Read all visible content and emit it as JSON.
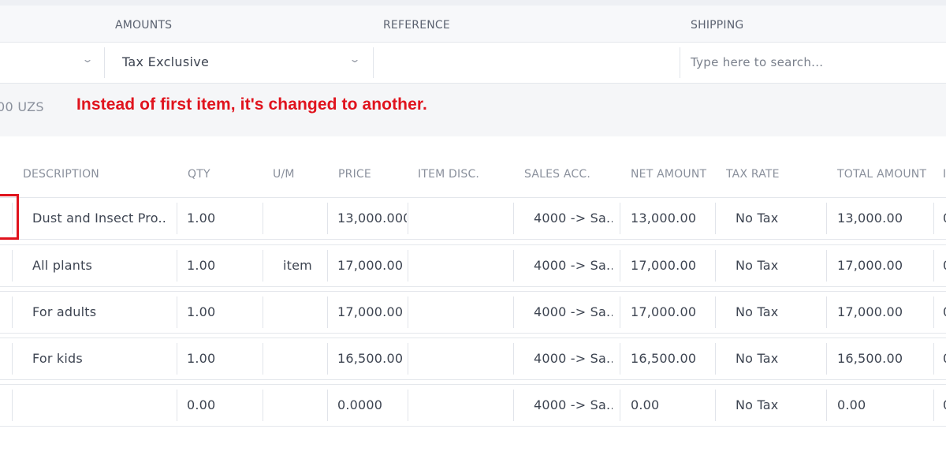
{
  "header": {
    "labels": {
      "amounts": "AMOUNTS",
      "reference": "REFERENCE",
      "shipping": "SHIPPING"
    },
    "amounts_select": {
      "value": "Tax Exclusive"
    },
    "reference_value": "",
    "shipping_search": {
      "placeholder": "Type here to search..."
    }
  },
  "info": {
    "currency_total": "00 UZS"
  },
  "annotation": {
    "text": "Instead of first item, it's changed to another.",
    "color": "#e0131d"
  },
  "table": {
    "columns": [
      "DESCRIPTION",
      "QTY",
      "U/M",
      "PRICE",
      "ITEM DISC.",
      "SALES ACC.",
      "NET AMOUNT",
      "TAX RATE",
      "TOTAL AMOUNT",
      "I"
    ],
    "rows": [
      {
        "description": "Dust and Insect Pro...",
        "qty": "1.00",
        "um": "",
        "price": "13,000.000",
        "disc": "",
        "sales_acc": "4000 -> Sa...",
        "net": "13,000.00",
        "tax": "No Tax",
        "total": "13,000.00",
        "trail": "0"
      },
      {
        "description": "All plants",
        "qty": "1.00",
        "um": "item",
        "price": "17,000.00",
        "disc": "",
        "sales_acc": "4000 -> Sa...",
        "net": "17,000.00",
        "tax": "No Tax",
        "total": "17,000.00",
        "trail": "0"
      },
      {
        "description": "For adults",
        "qty": "1.00",
        "um": "",
        "price": "17,000.00",
        "disc": "",
        "sales_acc": "4000 -> Sa...",
        "net": "17,000.00",
        "tax": "No Tax",
        "total": "17,000.00",
        "trail": "0"
      },
      {
        "description": "For kids",
        "qty": "1.00",
        "um": "",
        "price": "16,500.00",
        "disc": "",
        "sales_acc": "4000 -> Sa...",
        "net": "16,500.00",
        "tax": "No Tax",
        "total": "16,500.00",
        "trail": "0"
      },
      {
        "description": "",
        "qty": "0.00",
        "um": "",
        "price": "0.0000",
        "disc": "",
        "sales_acc": "4000 -> Sa...",
        "net": "0.00",
        "tax": "No Tax",
        "total": "0.00",
        "trail": "0"
      }
    ]
  },
  "icons": {
    "dropdown": "chevron-down-icon"
  },
  "colors": {
    "accent_red": "#e0131d",
    "header_bg": "#f7f8fa",
    "band_bg": "#f5f6f8"
  }
}
